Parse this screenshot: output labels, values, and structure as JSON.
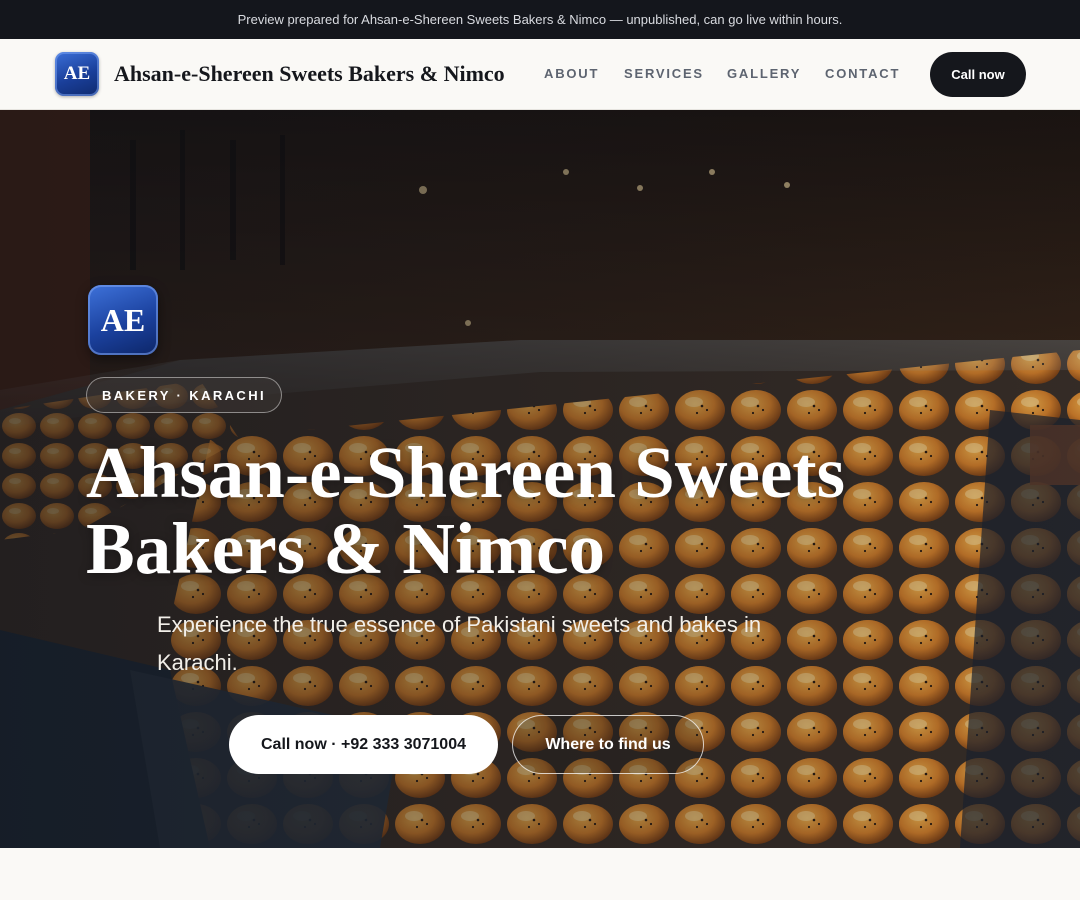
{
  "preview_banner": {
    "text": "Preview prepared for Ahsan-e-Shereen Sweets Bakers & Nimco — unpublished, can go live within hours."
  },
  "nav": {
    "logo_text": "AE",
    "brand": "Ahsan-e-Shereen Sweets Bakers & Nimco",
    "links": [
      "ABOUT",
      "SERVICES",
      "GALLERY",
      "CONTACT"
    ],
    "cta": "Call now"
  },
  "hero": {
    "logo_text": "AE",
    "badge": "BAKERY · KARACHI",
    "title": "Ahsan-e-Shereen Sweets Bakers & Nimco",
    "subtitle": "Experience the true essence of Pakistani sweets and bakes in Karachi.",
    "primary_button": "Call now · +92 333 3071004",
    "secondary_button": "Where to find us",
    "background_image": "bakery-display-case-with-buns"
  },
  "colors": {
    "dark": "#15171c",
    "logo_blue": "#1a3f9a",
    "page_bg": "#faf9f6"
  }
}
